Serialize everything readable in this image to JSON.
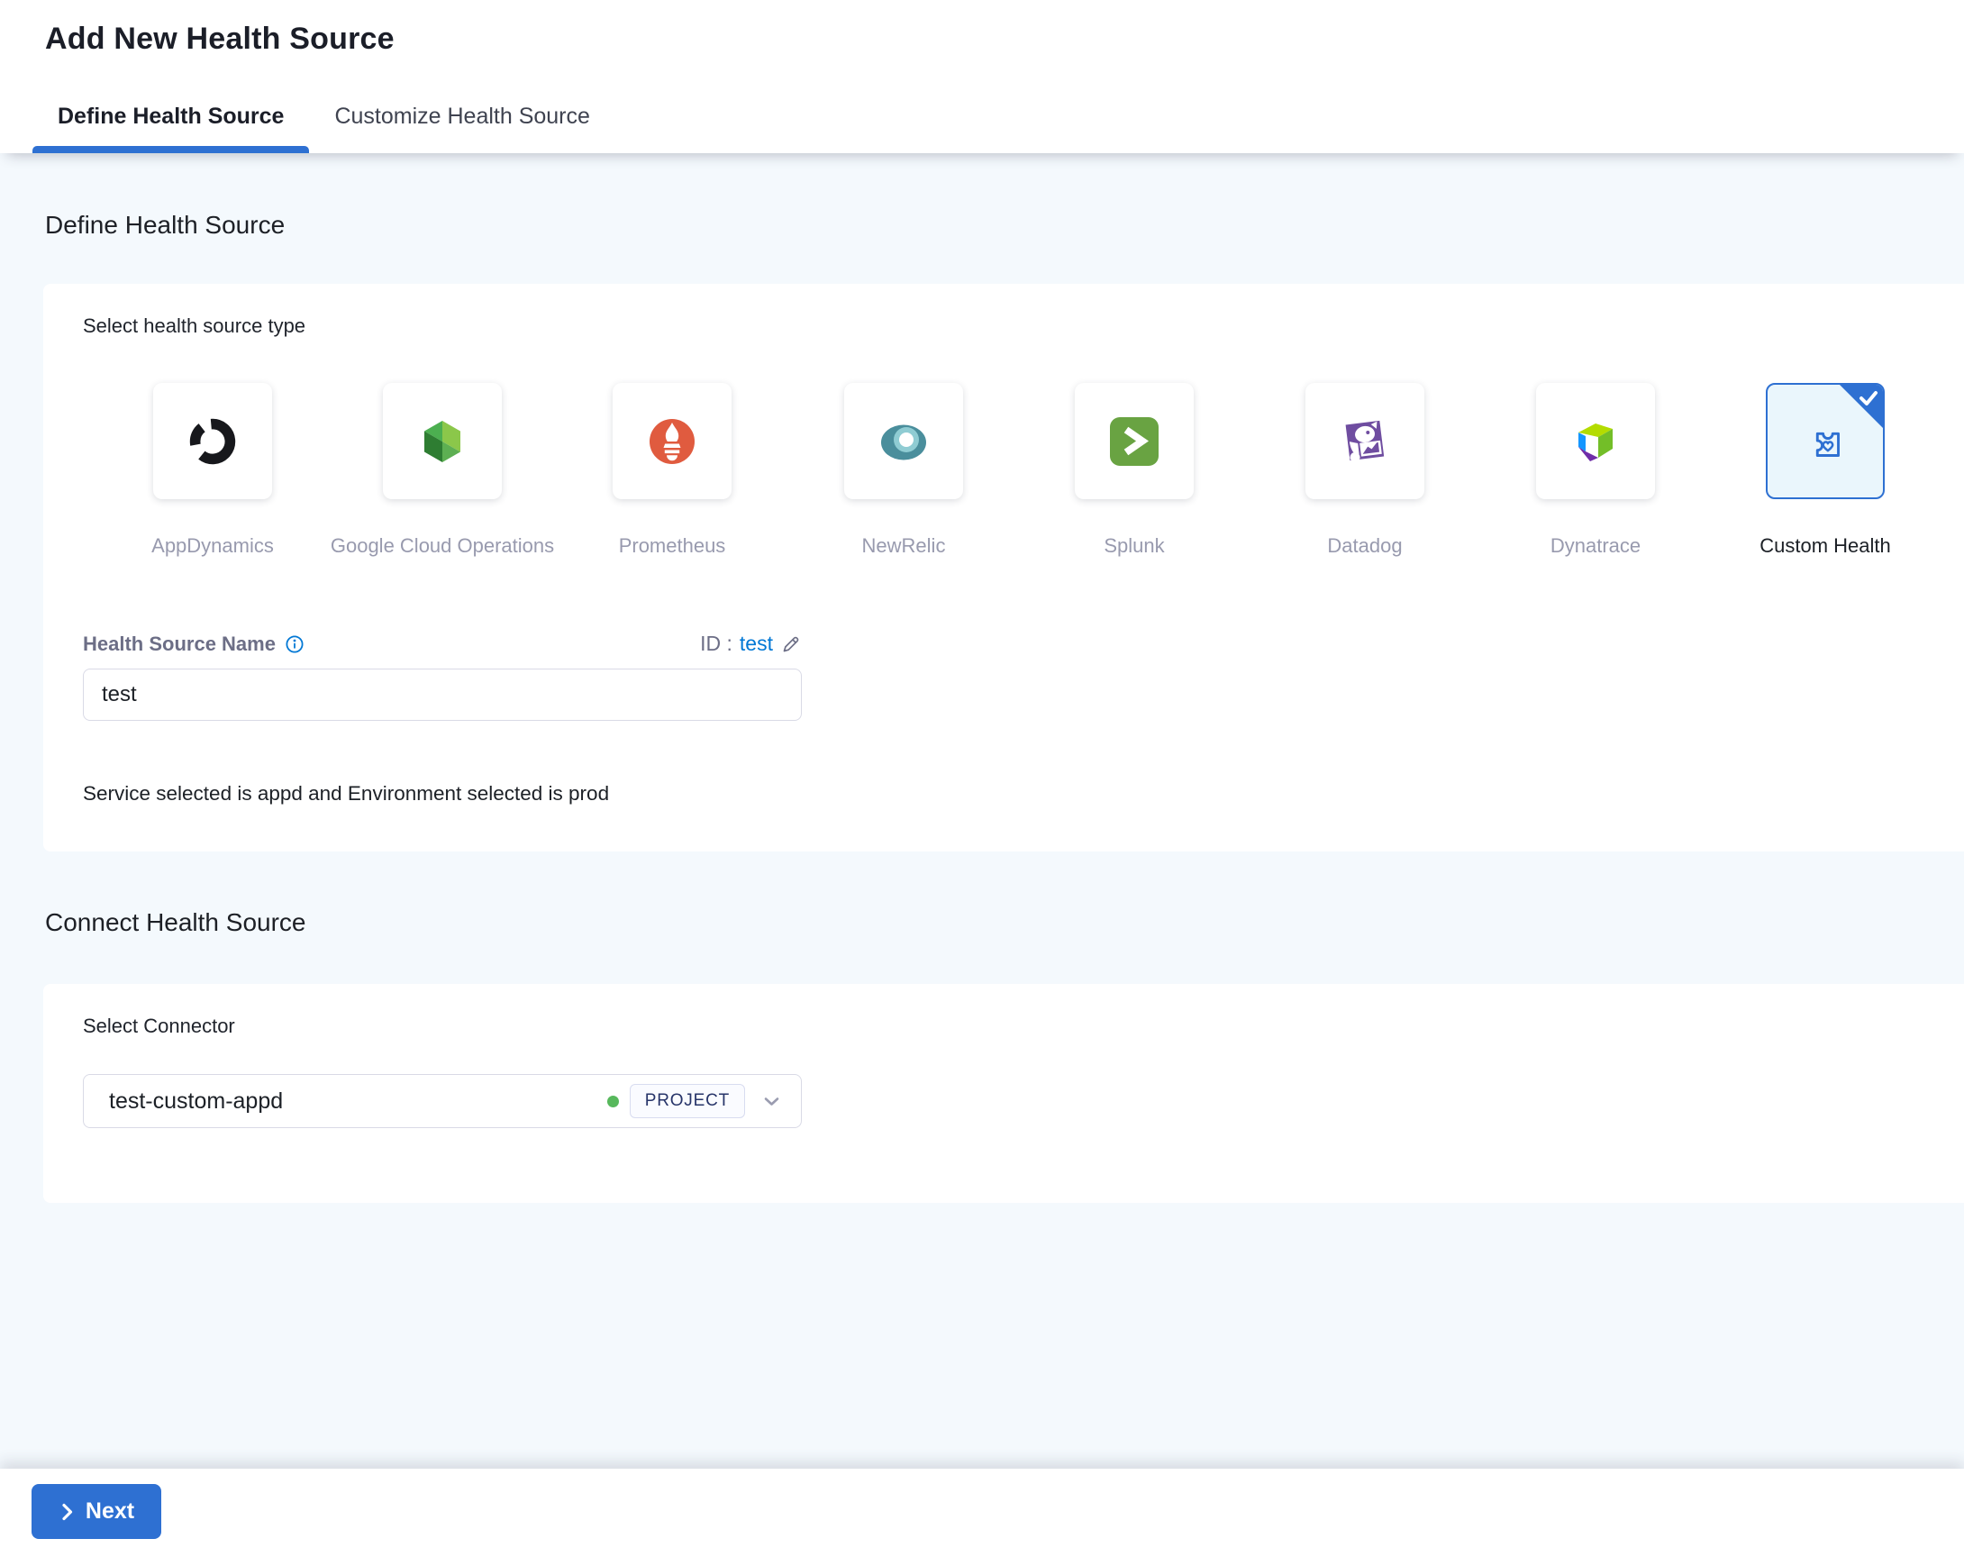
{
  "header": {
    "title": "Add New Health Source"
  },
  "tabs": {
    "define": "Define Health Source",
    "customize": "Customize Health Source"
  },
  "define": {
    "heading": "Define Health Source",
    "type_label": "Select health source type",
    "sources": [
      {
        "name": "AppDynamics",
        "icon": "appdynamics-icon",
        "selected": false
      },
      {
        "name": "Google Cloud Operations",
        "icon": "google-cloud-operations-icon",
        "selected": false
      },
      {
        "name": "Prometheus",
        "icon": "prometheus-icon",
        "selected": false
      },
      {
        "name": "NewRelic",
        "icon": "newrelic-icon",
        "selected": false
      },
      {
        "name": "Splunk",
        "icon": "splunk-icon",
        "selected": false
      },
      {
        "name": "Datadog",
        "icon": "datadog-icon",
        "selected": false
      },
      {
        "name": "Dynatrace",
        "icon": "dynatrace-icon",
        "selected": false
      },
      {
        "name": "Custom Health",
        "icon": "custom-health-icon",
        "selected": true
      }
    ],
    "name_label": "Health Source Name",
    "id_prefix": "ID :",
    "id_value": "test",
    "name_value": "test",
    "service_env_note": "Service selected is appd and Environment selected is prod"
  },
  "connect": {
    "heading": "Connect Health Source",
    "connector_label": "Select Connector",
    "connector_name": "test-custom-appd",
    "connector_scope": "PROJECT"
  },
  "footer": {
    "next": "Next"
  },
  "colors": {
    "primary": "#2e70d2",
    "link": "#0278d5",
    "page_bg": "#f4f9fd",
    "selected_card_bg": "#eaf6fc",
    "status_green": "#57b85c",
    "muted_label": "#989aae"
  }
}
